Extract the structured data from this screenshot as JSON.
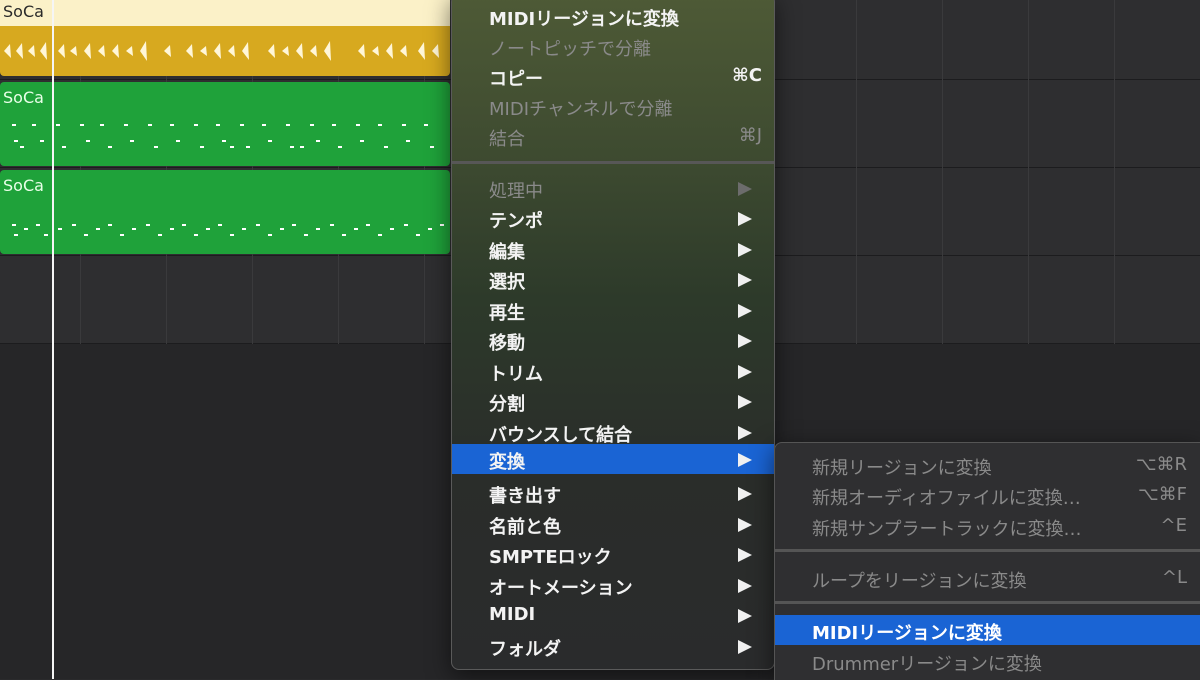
{
  "regions": {
    "audio_name": "SoCa",
    "midi1_name": "SoCa",
    "midi2_name": "SoCa"
  },
  "context_menu": {
    "items": [
      {
        "label": "MIDIリージョンに変換",
        "shortcut": "",
        "disabled": false
      },
      {
        "label": "ノートピッチで分離",
        "shortcut": "",
        "disabled": true
      },
      {
        "label": "コピー",
        "shortcut": "⌘C",
        "disabled": false
      },
      {
        "label": "MIDIチャンネルで分離",
        "shortcut": "",
        "disabled": true
      },
      {
        "label": "結合",
        "shortcut": "⌘J",
        "disabled": true
      },
      {
        "label": "処理中",
        "shortcut": "",
        "disabled": true,
        "submenu": true
      },
      {
        "label": "テンポ",
        "shortcut": "",
        "disabled": false,
        "submenu": true
      },
      {
        "label": "編集",
        "shortcut": "",
        "disabled": false,
        "submenu": true
      },
      {
        "label": "選択",
        "shortcut": "",
        "disabled": false,
        "submenu": true
      },
      {
        "label": "再生",
        "shortcut": "",
        "disabled": false,
        "submenu": true
      },
      {
        "label": "移動",
        "shortcut": "",
        "disabled": false,
        "submenu": true
      },
      {
        "label": "トリム",
        "shortcut": "",
        "disabled": false,
        "submenu": true
      },
      {
        "label": "分割",
        "shortcut": "",
        "disabled": false,
        "submenu": true
      },
      {
        "label": "バウンスして結合",
        "shortcut": "",
        "disabled": false,
        "submenu": true
      },
      {
        "label": "変換",
        "shortcut": "",
        "disabled": false,
        "submenu": true,
        "highlighted": true
      },
      {
        "label": "書き出す",
        "shortcut": "",
        "disabled": false,
        "submenu": true
      },
      {
        "label": "名前と色",
        "shortcut": "",
        "disabled": false,
        "submenu": true
      },
      {
        "label": "SMPTEロック",
        "shortcut": "",
        "disabled": false,
        "submenu": true
      },
      {
        "label": "オートメーション",
        "shortcut": "",
        "disabled": false,
        "submenu": true
      },
      {
        "label": "MIDI",
        "shortcut": "",
        "disabled": false,
        "submenu": true
      },
      {
        "label": "フォルダ",
        "shortcut": "",
        "disabled": false,
        "submenu": true
      }
    ]
  },
  "submenu": {
    "items": [
      {
        "label": "新規リージョンに変換",
        "shortcut": "⌥⌘R",
        "disabled": true
      },
      {
        "label": "新規オーディオファイルに変換…",
        "shortcut": "⌥⌘F",
        "disabled": true
      },
      {
        "label": "新規サンプラートラックに変換…",
        "shortcut": "^E",
        "disabled": true
      },
      {
        "label": "ループをリージョンに変換",
        "shortcut": "^L",
        "disabled": true
      },
      {
        "label": "MIDIリージョンに変換",
        "shortcut": "",
        "disabled": false,
        "highlighted": true
      },
      {
        "label": "Drummerリージョンに変換",
        "shortcut": "",
        "disabled": true
      }
    ]
  },
  "colors": {
    "audio_region": "#d7a91f",
    "midi_region": "#1fa23a",
    "highlight": "#1a64d4"
  }
}
